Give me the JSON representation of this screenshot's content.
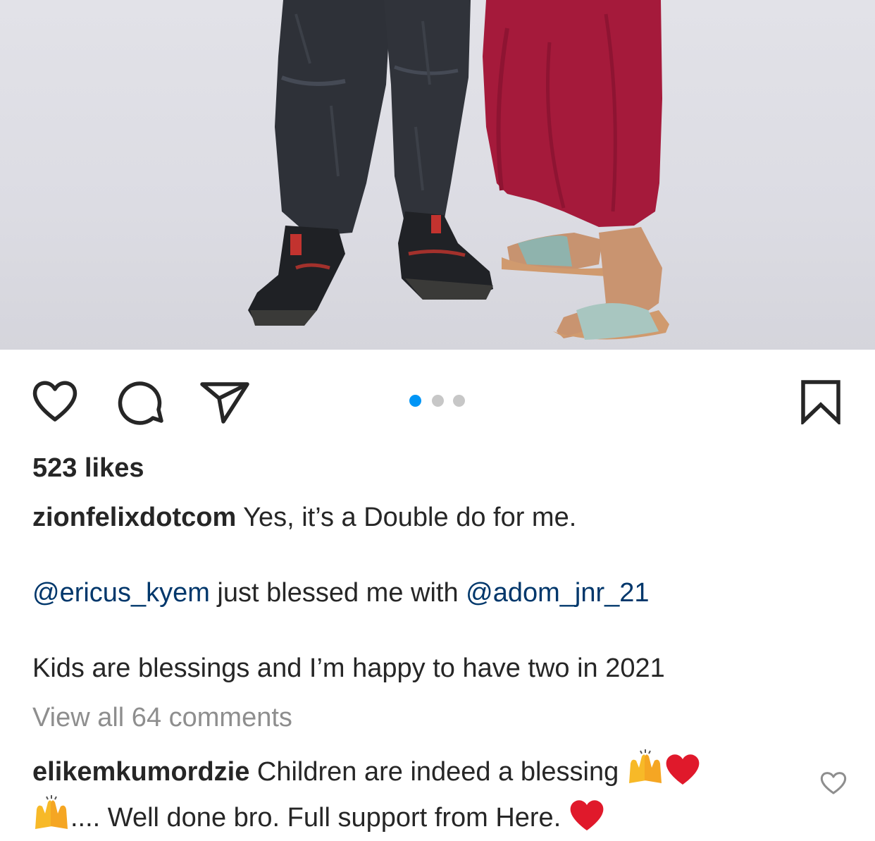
{
  "post": {
    "likes": "523 likes",
    "caption": {
      "username": "zionfelixdotcom",
      "line1": " Yes, it’s a Double do for me.",
      "mention1": "@ericus_kyem",
      "middle": " just blessed me with ",
      "mention2": "@adom_jnr_21",
      "line3": "Kids are blessings and I’m happy to have two in 2021"
    },
    "view_all_comments": "View all 64 comments",
    "carousel": {
      "count": 3,
      "active_index": 0,
      "active_color": "#0095f6",
      "inactive_color": "#c7c7c7"
    }
  },
  "comment": {
    "username": "elikemkumordzie",
    "text1": " Children are indeed a blessing ",
    "text2": ".... Well done bro. Full support from Here. ",
    "emojis": [
      "raising-hands-emoji",
      "red-heart-emoji"
    ]
  },
  "icons": {
    "like": "heart-icon",
    "comment": "comment-bubble-icon",
    "share": "paper-plane-icon",
    "save": "bookmark-icon",
    "comment_like": "heart-outline-icon"
  },
  "colors": {
    "text": "#262626",
    "mention": "#00376b",
    "muted": "#8e8e8e",
    "accent": "#0095f6"
  }
}
